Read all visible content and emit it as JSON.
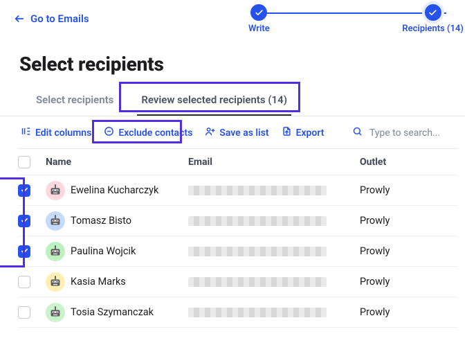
{
  "back_label": "Go to Emails",
  "steps": {
    "step1": "Write",
    "step2": "Recipients (14)"
  },
  "page_title": "Select recipients",
  "tabs": {
    "select": "Select recipients",
    "review": "Review selected recipients (14)"
  },
  "actions": {
    "edit_columns": "Edit columns",
    "exclude": "Exclude contacts",
    "save_list": "Save as list",
    "export": "Export"
  },
  "search": {
    "placeholder": "Type to search..."
  },
  "table": {
    "columns": {
      "name": "Name",
      "email": "Email",
      "outlet": "Outlet"
    },
    "rows": [
      {
        "checked": true,
        "avatar": "a",
        "name": "Ewelina Kucharczyk",
        "outlet": "Prowly"
      },
      {
        "checked": true,
        "avatar": "b",
        "name": "Tomasz Bisto",
        "outlet": "Prowly"
      },
      {
        "checked": true,
        "avatar": "c",
        "name": "Paulina Wojcik",
        "outlet": "Prowly"
      },
      {
        "checked": false,
        "avatar": "d",
        "name": "Kasia Marks",
        "outlet": "Prowly"
      },
      {
        "checked": false,
        "avatar": "e",
        "name": "Tosia Szymanczak",
        "outlet": "Prowly"
      }
    ]
  }
}
